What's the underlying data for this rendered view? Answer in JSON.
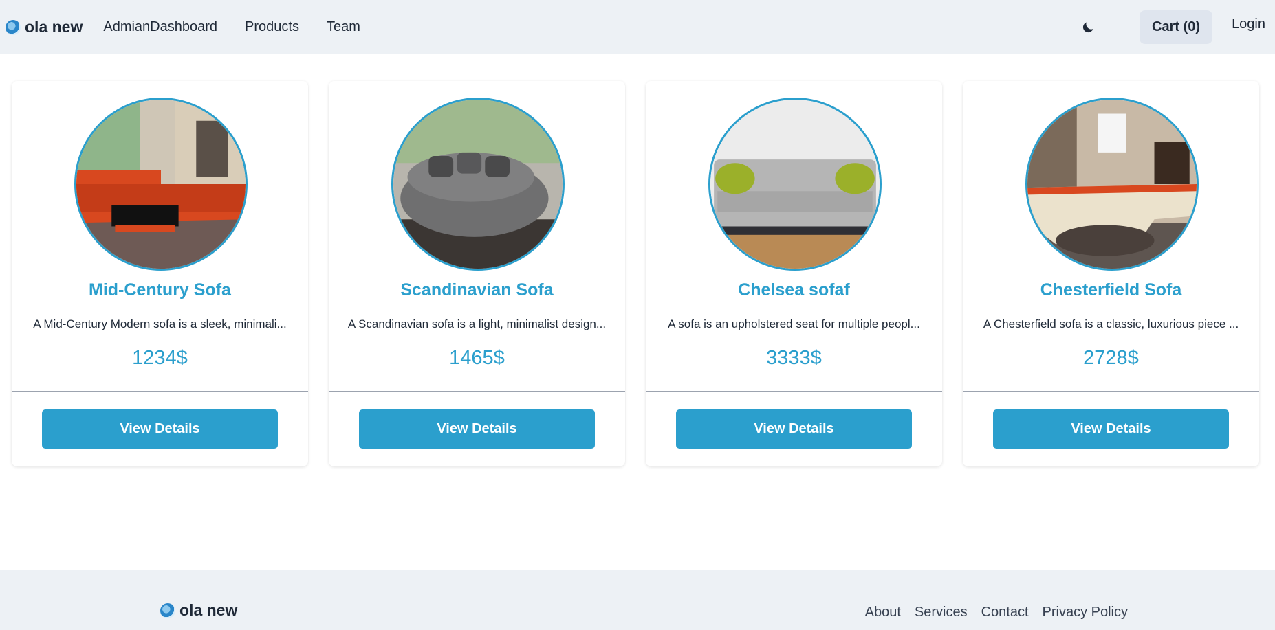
{
  "navbar": {
    "brand": "ola new",
    "links": [
      "AdmianDashboard",
      "Products",
      "Team"
    ],
    "cart_label": "Cart (0)",
    "login_label": "Login"
  },
  "products": [
    {
      "title": "Mid-Century Sofa",
      "description": "A Mid-Century Modern sofa is a sleek, minimali...",
      "price": "1234$",
      "button": "View Details"
    },
    {
      "title": "Scandinavian Sofa",
      "description": "A Scandinavian sofa is a light, minimalist design...",
      "price": "1465$",
      "button": "View Details"
    },
    {
      "title": "Chelsea sofaf",
      "description": "A sofa is an upholstered seat for multiple peopl...",
      "price": "3333$",
      "button": "View Details"
    },
    {
      "title": "Chesterfield Sofa",
      "description": "A Chesterfield sofa is a classic, luxurious piece ...",
      "price": "2728$",
      "button": "View Details"
    }
  ],
  "footer": {
    "brand": "ola new",
    "links": [
      "About",
      "Services",
      "Contact",
      "Privacy Policy"
    ]
  },
  "colors": {
    "accent": "#2b9fcd",
    "nav_bg": "#edf1f5"
  }
}
